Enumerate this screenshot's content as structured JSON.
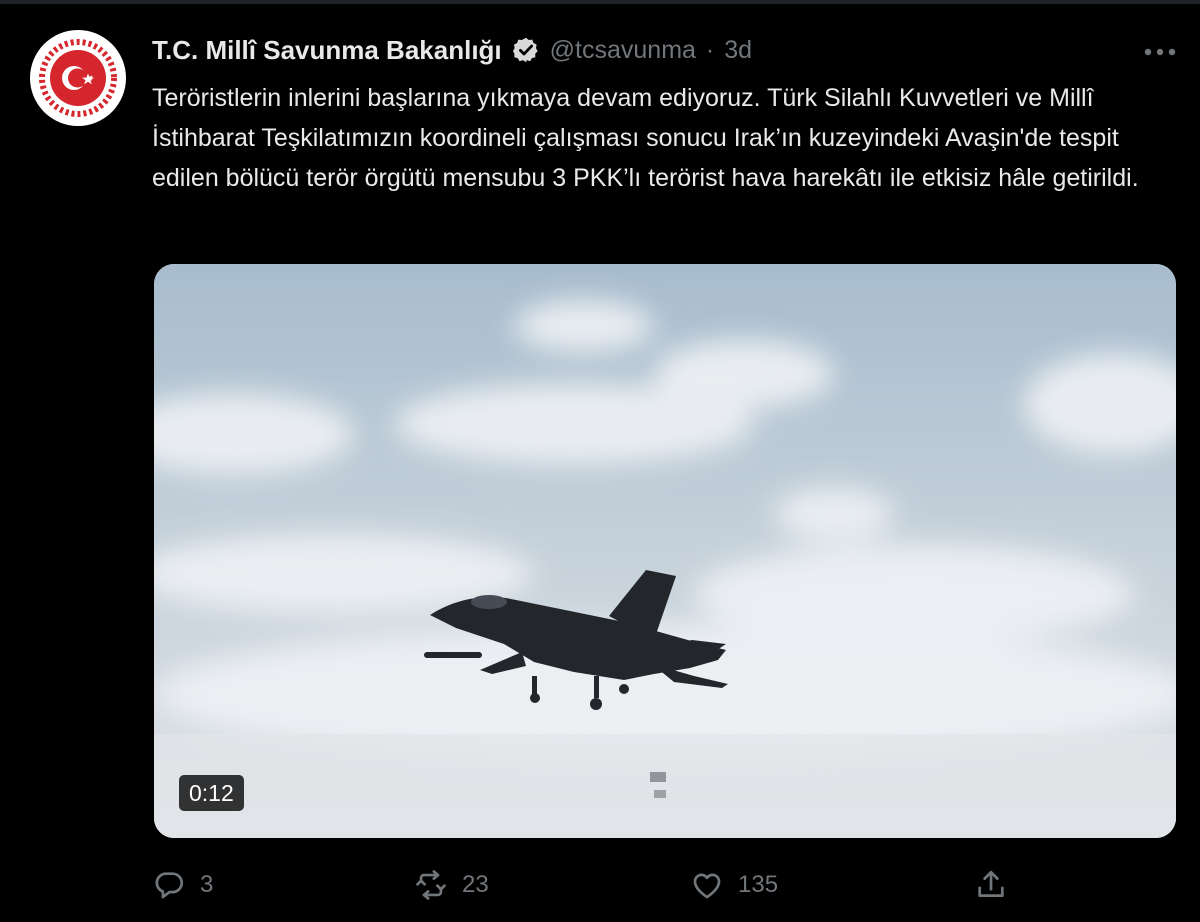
{
  "tweet": {
    "display_name": "T.C. Millî Savunma Bakanlığı",
    "handle": "@tcsavunma",
    "separator": "·",
    "time": "3d",
    "text": "Teröristlerin inlerini başlarına yıkmaya devam ediyoruz. Türk Silahlı Kuvvetleri ve Millî İstihbarat Teşkilatımızın koordineli çalışması sonucu Irak’ın kuzeyindeki Avaşin'de tespit edilen bölücü terör örgütü mensubu 3 PKK’lı terörist hava harekâtı ile etkisiz hâle getirildi.",
    "media": {
      "duration": "0:12"
    },
    "actions": {
      "reply_count": "3",
      "retweet_count": "23",
      "like_count": "135"
    }
  },
  "icons": {
    "verified": "verified-badge-icon",
    "more": "more-options-icon",
    "reply": "reply-icon",
    "retweet": "retweet-icon",
    "like": "like-icon",
    "share": "share-icon"
  },
  "colors": {
    "background": "#000000",
    "text_primary": "#e7e9ea",
    "text_secondary": "#71767b",
    "emblem_red": "#d4262c"
  }
}
